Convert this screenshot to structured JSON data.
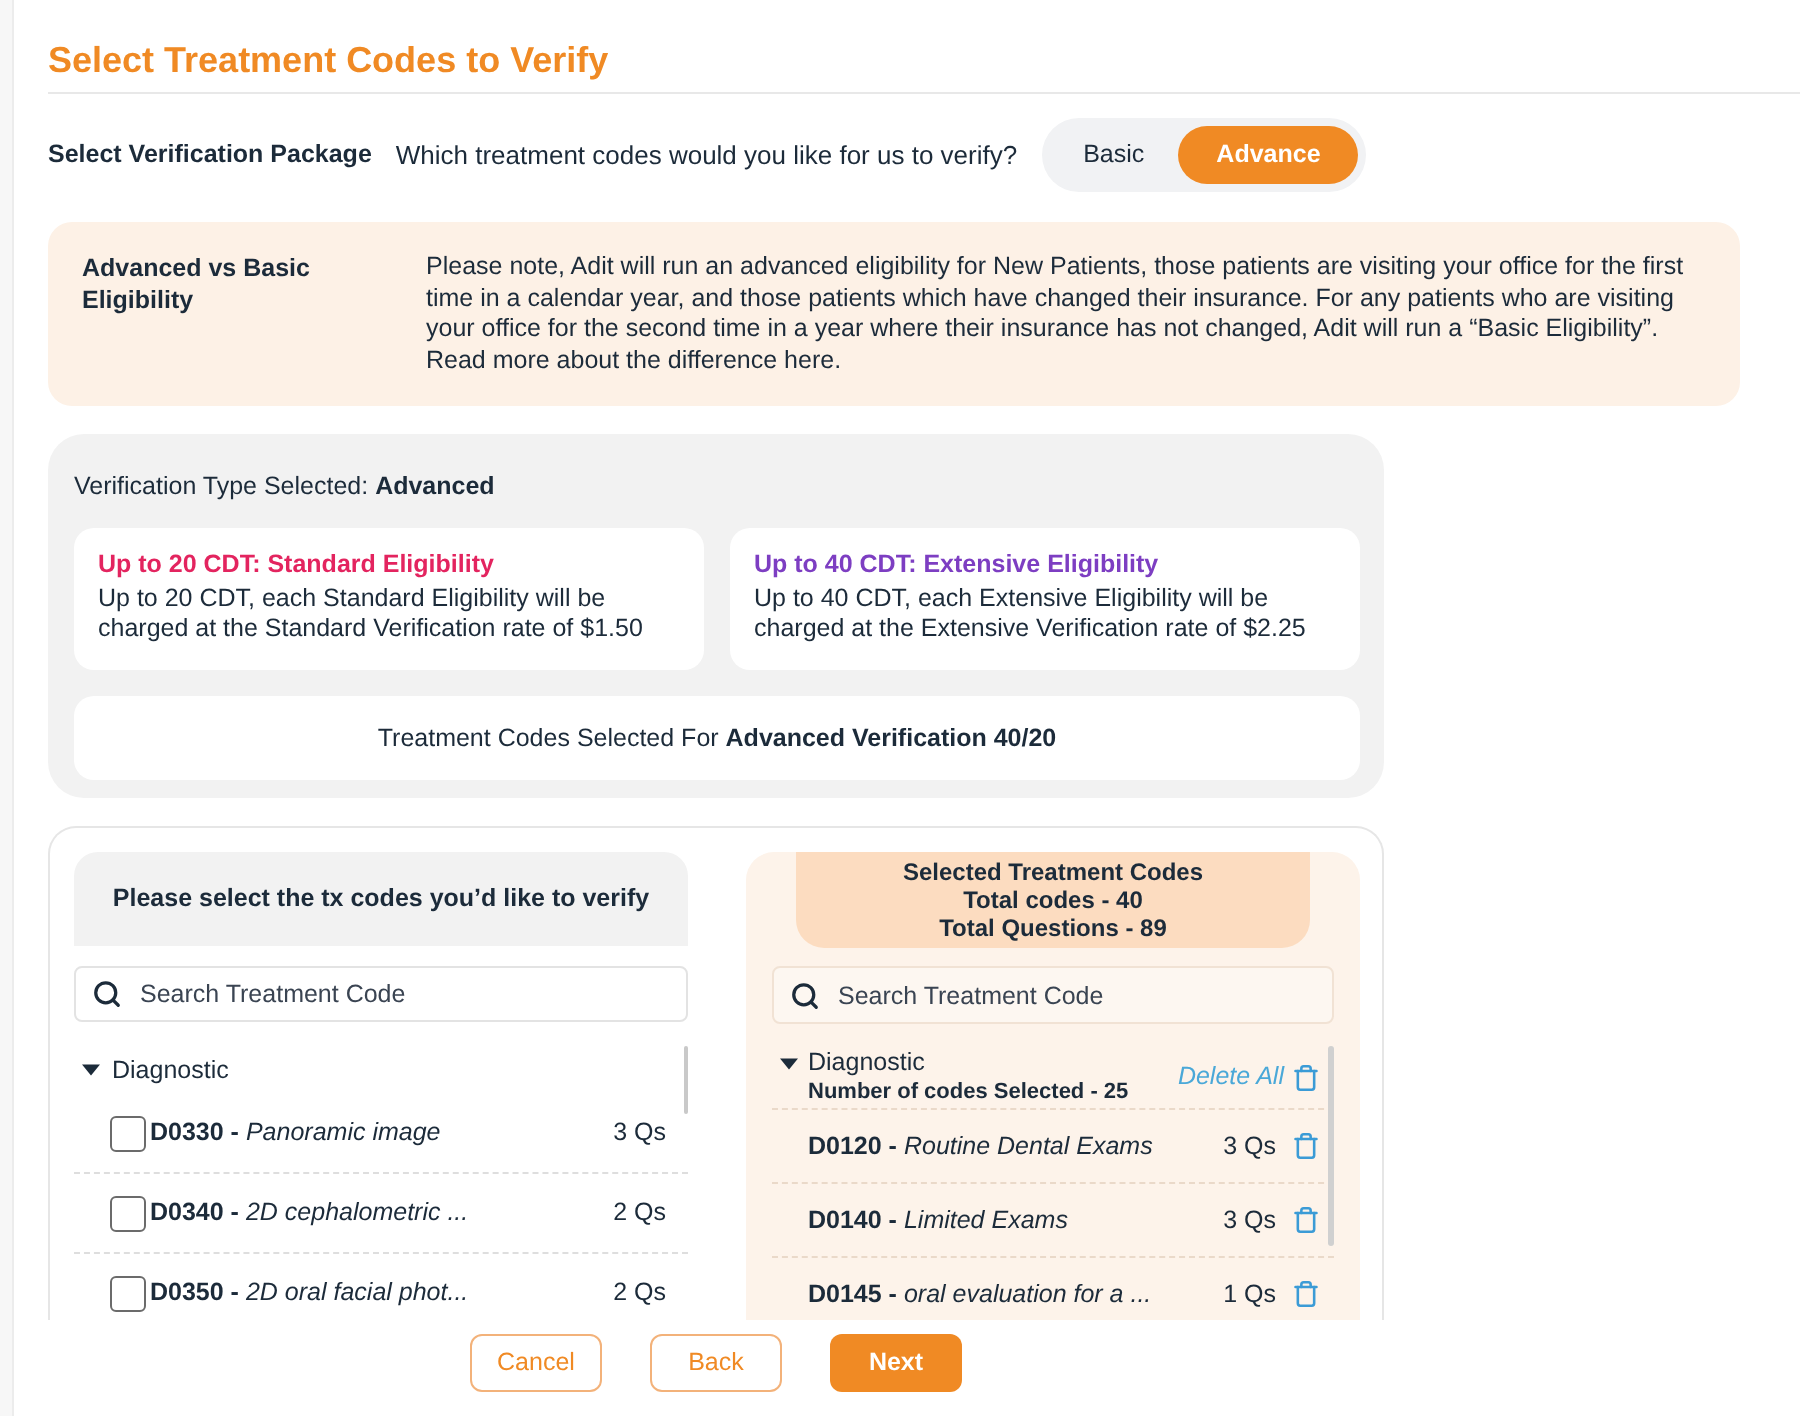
{
  "page": {
    "title": "Select Treatment Codes to Verify"
  },
  "package": {
    "label": "Select Verification Package",
    "question": "Which treatment codes would you like for us to verify?",
    "options": [
      {
        "label": "Basic",
        "selected": false
      },
      {
        "label": "Advance",
        "selected": true
      }
    ]
  },
  "note": {
    "title": "Advanced vs Basic Eligibility",
    "text": "Please note, Adit will run an advanced eligibility for New Patients, those patients are visiting your office for the first time in a calendar year, and those patients which have changed their insurance. For any patients who are visiting your office for the second time in a year where their insurance has not changed, Adit will run a “Basic Eligibility”. Read more about the difference here."
  },
  "verification": {
    "type_text": "Verification Type Selected: **Advanced**",
    "tiers": [
      {
        "title": "Up to 20 CDT: Standard Eligibility",
        "color": "#e3245f",
        "text": "Up to 20 CDT, each Standard Eligibility will be charged at the Standard Verification rate of $1.50"
      },
      {
        "title": "Up to 40 CDT: Extensive Eligibility",
        "color": "#7d3ec2",
        "text": "Up to 40 CDT, each Extensive Eligibility will be charged at the Extensive Verification rate of $2.25"
      }
    ],
    "summary": "Treatment Codes Selected For **Advanced Verification 40/20**"
  },
  "available": {
    "heading": "Please select the tx codes you’d like to verify",
    "search": {
      "placeholder": "Search Treatment Code"
    },
    "groups": [
      {
        "name": "Diagnostic",
        "expanded": true,
        "children": [
          {
            "code": "D0330 -",
            "description": "Panoramic image",
            "questions": "3 Qs",
            "checked": false
          },
          {
            "code": "D0340 -",
            "description": "2D cephalometric ...",
            "questions": "2 Qs",
            "checked": false
          },
          {
            "code": "D0350 -",
            "description": "2D oral facial phot...",
            "questions": "2 Qs",
            "checked": false
          }
        ]
      }
    ]
  },
  "selected": {
    "heading": [
      "Selected Treatment Codes",
      "Total codes - 40",
      "Total Questions - 89"
    ],
    "search": {
      "placeholder": "Search Treatment Code"
    },
    "groups": [
      {
        "name": "Diagnostic",
        "expanded": true,
        "count": "Number of codes Selected - 25",
        "delete_all": "Delete All",
        "children": [
          {
            "code": "D0120 -",
            "description": "Routine Dental Exams",
            "questions": "3 Qs"
          },
          {
            "code": "D0140 -",
            "description": "Limited Exams",
            "questions": "3 Qs"
          },
          {
            "code": "D0145 -",
            "description": "oral evaluation for a ...",
            "questions": "1 Qs"
          }
        ]
      }
    ]
  },
  "footer": {
    "buttons": [
      {
        "label": "Cancel",
        "kind": "outline"
      },
      {
        "label": "Back",
        "kind": "outline"
      },
      {
        "label": "Next",
        "kind": "primary"
      }
    ]
  }
}
